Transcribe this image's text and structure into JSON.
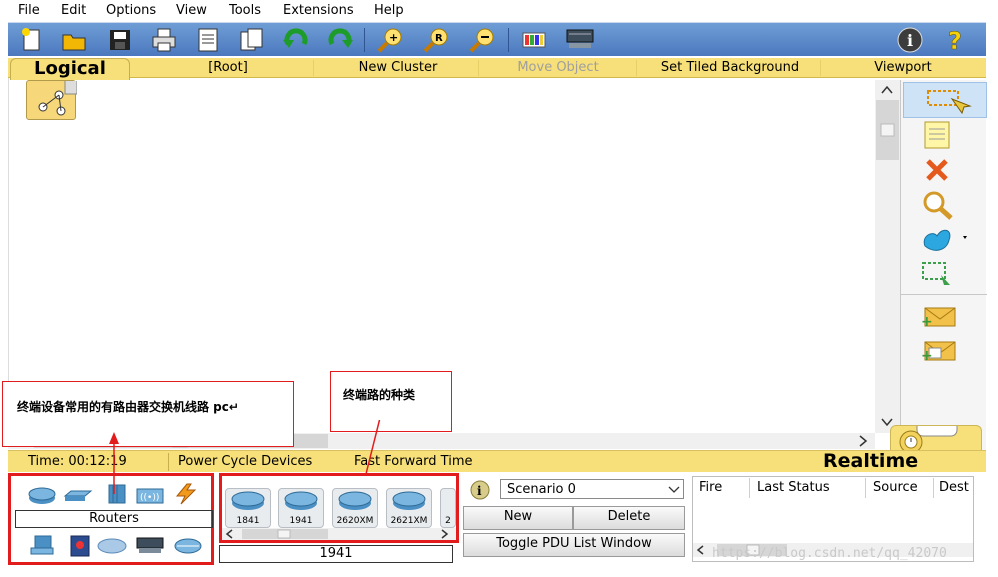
{
  "menu": [
    "File",
    "Edit",
    "Options",
    "View",
    "Tools",
    "Extensions",
    "Help"
  ],
  "workspace": {
    "tab": "Logical",
    "items": [
      "[Root]",
      "New Cluster",
      "Move Object",
      "Set Tiled Background",
      "Viewport"
    ]
  },
  "status": {
    "time": "Time: 00:12:19",
    "power_cycle": "Power Cycle Devices",
    "fast_forward": "Fast Forward Time",
    "mode": "Realtime"
  },
  "devices": {
    "category_label": "Routers",
    "selected_model": "1941",
    "models": [
      "1841",
      "1941",
      "2620XM",
      "2621XM",
      "2"
    ]
  },
  "scenario": {
    "select_value": "Scenario 0",
    "new": "New",
    "delete": "Delete",
    "toggle": "Toggle PDU List Window"
  },
  "pdu_table": {
    "columns": [
      "Fire",
      "Last Status",
      "Source",
      "Dest"
    ]
  },
  "annotations": {
    "left": "终端设备常用的有路由器交换机线路 pc↵",
    "center": "终端路的种类"
  },
  "watermark": "https://blog.csdn.net/qq_42070"
}
